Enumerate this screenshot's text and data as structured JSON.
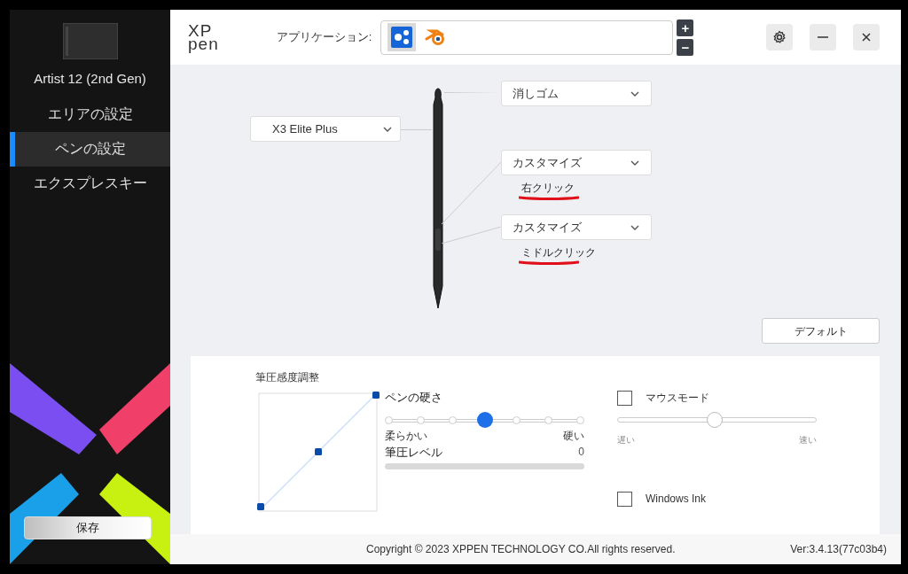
{
  "sidebar": {
    "device_name": "Artist 12 (2nd Gen)",
    "items": [
      {
        "label": "エリアの設定",
        "selected": false
      },
      {
        "label": "ペンの設定",
        "selected": true
      },
      {
        "label": "エクスプレスキー",
        "selected": false
      }
    ],
    "save_button": "保存"
  },
  "header": {
    "logo": [
      "XP",
      "pen"
    ],
    "app_label": "アプリケーション:",
    "apps": [
      {
        "kind": "dots",
        "selected": true
      },
      {
        "kind": "eye",
        "selected": false
      }
    ],
    "add_button": "+",
    "remove_button": "−"
  },
  "pen": {
    "model": "X3 Elite Plus",
    "buttons": [
      {
        "value": "消しゴム"
      },
      {
        "value": "カスタマイズ",
        "action": "右クリック",
        "underlined": true
      },
      {
        "value": "カスタマイズ",
        "action": "ミドルクリック",
        "underlined": true
      }
    ],
    "default_button": "デフォルト"
  },
  "pressure": {
    "title": "筆圧感度調整",
    "hardness_title": "ペンの硬さ",
    "hardness": {
      "level": 0.5
    },
    "soft_label": "柔らかい",
    "hard_label": "硬い",
    "level_title": "筆圧レベル",
    "level_value": "0",
    "pressure_level": {
      "level": 0
    }
  },
  "mouse": {
    "mouse_mode": {
      "label": "マウスモード",
      "checked": false
    },
    "speed": {
      "level": 0.49
    },
    "slow_label": "遅い",
    "fast_label": "速い",
    "windows_ink": {
      "label": "Windows Ink",
      "checked": false
    }
  },
  "footer": {
    "copyright": "Copyright © 2023  XPPEN TECHNOLOGY CO.All rights reserved.",
    "version": "Ver:3.4.13(77c03b4)"
  }
}
